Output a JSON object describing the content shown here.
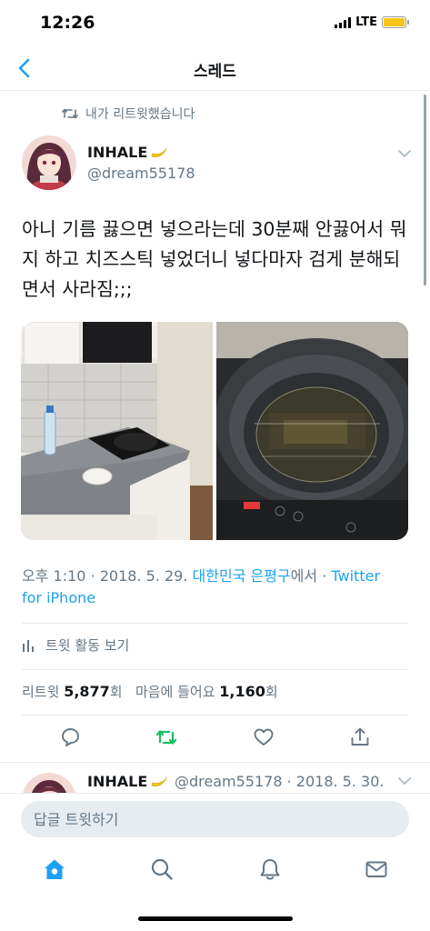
{
  "status_bar": {
    "time": "12:26",
    "network": "LTE"
  },
  "header": {
    "title": "스레드"
  },
  "retweet_context": "내가 리트윗했습니다",
  "author": {
    "name": "INHALE",
    "handle": "@dream55178"
  },
  "tweet": {
    "text": "아니 기름 끓으면 넣으라는데 30분째 안끓어서 뭐지 하고 치즈스틱 넣었더니 넣다마자 검게 분해되면서 사라짐;;;",
    "images": [
      "kitchen-photo",
      "pan-oil-photo"
    ]
  },
  "meta": {
    "time": "오후 1:10",
    "sep1": "·",
    "date": "2018. 5. 29.",
    "location": "대한민국 은평구",
    "location_suffix": "에서",
    "sep2": "·",
    "source": "Twitter for iPhone"
  },
  "activity_label": "트윗 활동 보기",
  "counts": {
    "retweets_label": "리트윗",
    "retweets": "5,877",
    "retweets_unit": "회",
    "likes_label": "마음에 들어요",
    "likes": "1,160",
    "likes_unit": "회"
  },
  "next_tweet": {
    "name": "INHALE",
    "handle_date": "@dream55178 · 2018. 5. 30."
  },
  "reply": {
    "placeholder": "답글 트윗하기"
  },
  "colors": {
    "accent": "#1da1f2",
    "retweet_green": "#17bf63",
    "muted": "#657786",
    "divider": "#e6ecf0"
  }
}
